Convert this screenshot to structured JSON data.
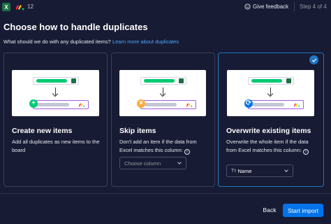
{
  "topbar": {
    "excel_icon_letter": "X",
    "board_count": "12",
    "feedback_label": "Give feedback",
    "step_label": "Step 4 of 4"
  },
  "header": {
    "title": "Choose how to handle duplicates",
    "question": "What should we do with any duplicated items?",
    "learn_more_link": "Learn more about duplicates"
  },
  "options": [
    {
      "title": "Create new items",
      "description": "Add all duplicates as new items to the board",
      "mark_symbol": "+",
      "selected": false
    },
    {
      "title": "Skip items",
      "description": "Don't add an item if the data from Excel matches this column:",
      "dropdown_placeholder": "Choose column",
      "mark_symbol": "×",
      "selected": false
    },
    {
      "title": "Overwrite existing items",
      "description": "Overwrite the whole item if the data from Excel matches this column:",
      "dropdown_value": "Name",
      "mark_symbol": "⟳",
      "selected": true
    }
  ],
  "footer": {
    "back_label": "Back",
    "start_label": "Start import"
  },
  "colors": {
    "background": "#181b34",
    "accent": "#0073ea",
    "excel_green": "#1d7044",
    "status_green": "#00c875",
    "skip_orange": "#fdab3d"
  }
}
